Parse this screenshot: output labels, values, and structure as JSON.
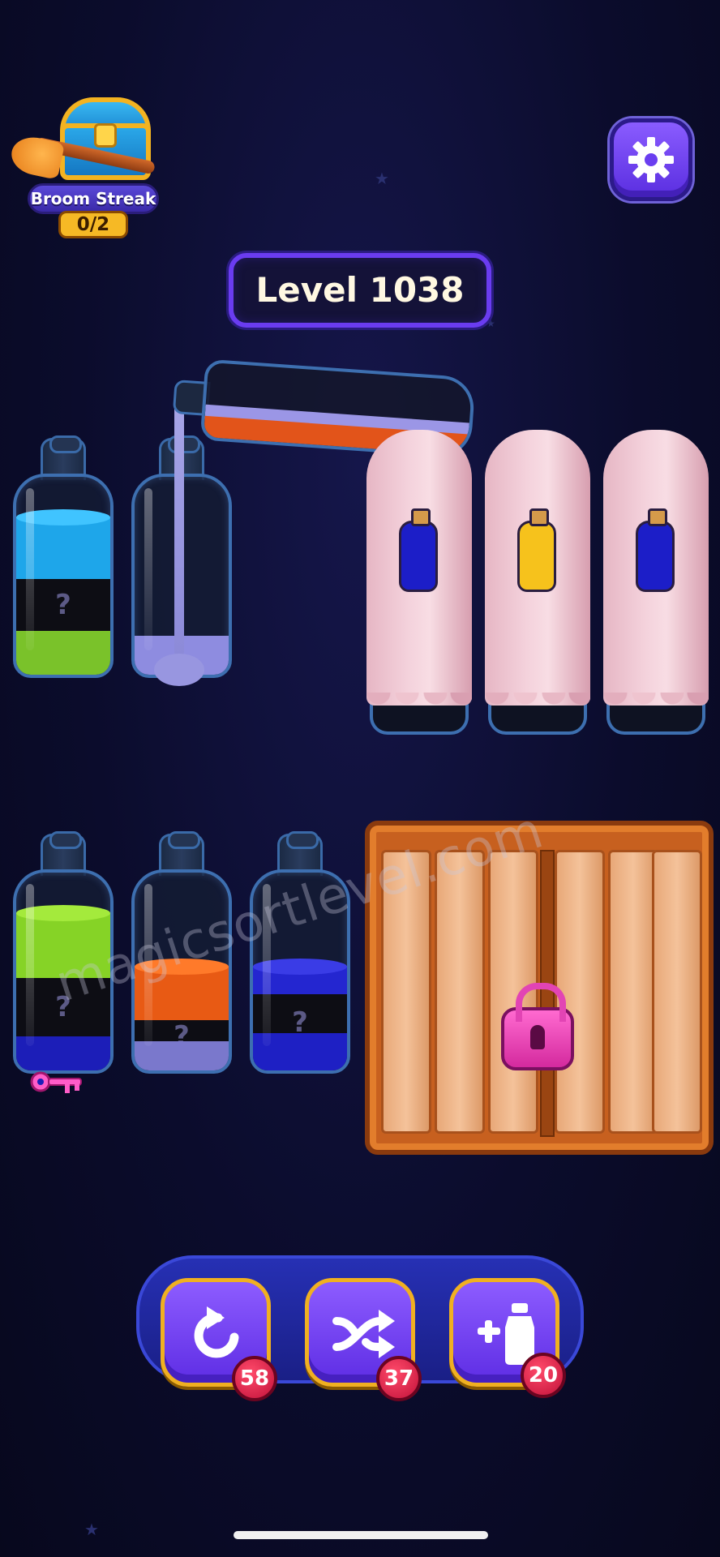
{
  "streak": {
    "title": "Broom Streak",
    "progress": "0/2"
  },
  "level": {
    "label": "Level 1038"
  },
  "bottles_row1": [
    {
      "id": "b1",
      "segments": [
        {
          "color": "#1ea6ea",
          "kind": "liquid"
        },
        {
          "kind": "unknown",
          "label": "?"
        },
        {
          "color": "#7ac22a",
          "kind": "liquid"
        }
      ]
    },
    {
      "id": "b2",
      "segments": [
        {
          "color": "#8e8ce0",
          "kind": "liquid"
        }
      ]
    }
  ],
  "pouring_bottle": {
    "colors": [
      "#9b96e6",
      "#e2541a"
    ]
  },
  "covered_bottles": [
    {
      "tag_color": "#1c1ec8"
    },
    {
      "tag_color": "#f6c21c"
    },
    {
      "tag_color": "#1c1ec8"
    }
  ],
  "bottles_row2": [
    {
      "id": "b6",
      "segments": [
        {
          "color": "#86d326",
          "kind": "liquid"
        },
        {
          "kind": "unknown",
          "label": "?"
        },
        {
          "color": "#1c1eb8",
          "kind": "liquid"
        }
      ],
      "key": true
    },
    {
      "id": "b7",
      "segments": [
        {
          "color": "#e85a14",
          "kind": "liquid"
        },
        {
          "kind": "unknown",
          "label": "?"
        },
        {
          "color": "#7a78cc",
          "kind": "liquid"
        }
      ]
    },
    {
      "id": "b8",
      "segments": [
        {
          "color": "#2426d0",
          "kind": "liquid"
        },
        {
          "kind": "unknown",
          "label": "?"
        },
        {
          "color": "#1e20c4",
          "kind": "liquid"
        }
      ]
    }
  ],
  "watermark": "magicsortlevel.com",
  "boosters": [
    {
      "name": "undo",
      "count": "58",
      "icon": "undo-icon"
    },
    {
      "name": "shuffle",
      "count": "37",
      "icon": "shuffle-icon"
    },
    {
      "name": "add-bottle",
      "count": "20",
      "icon": "add-bottle-icon"
    }
  ]
}
